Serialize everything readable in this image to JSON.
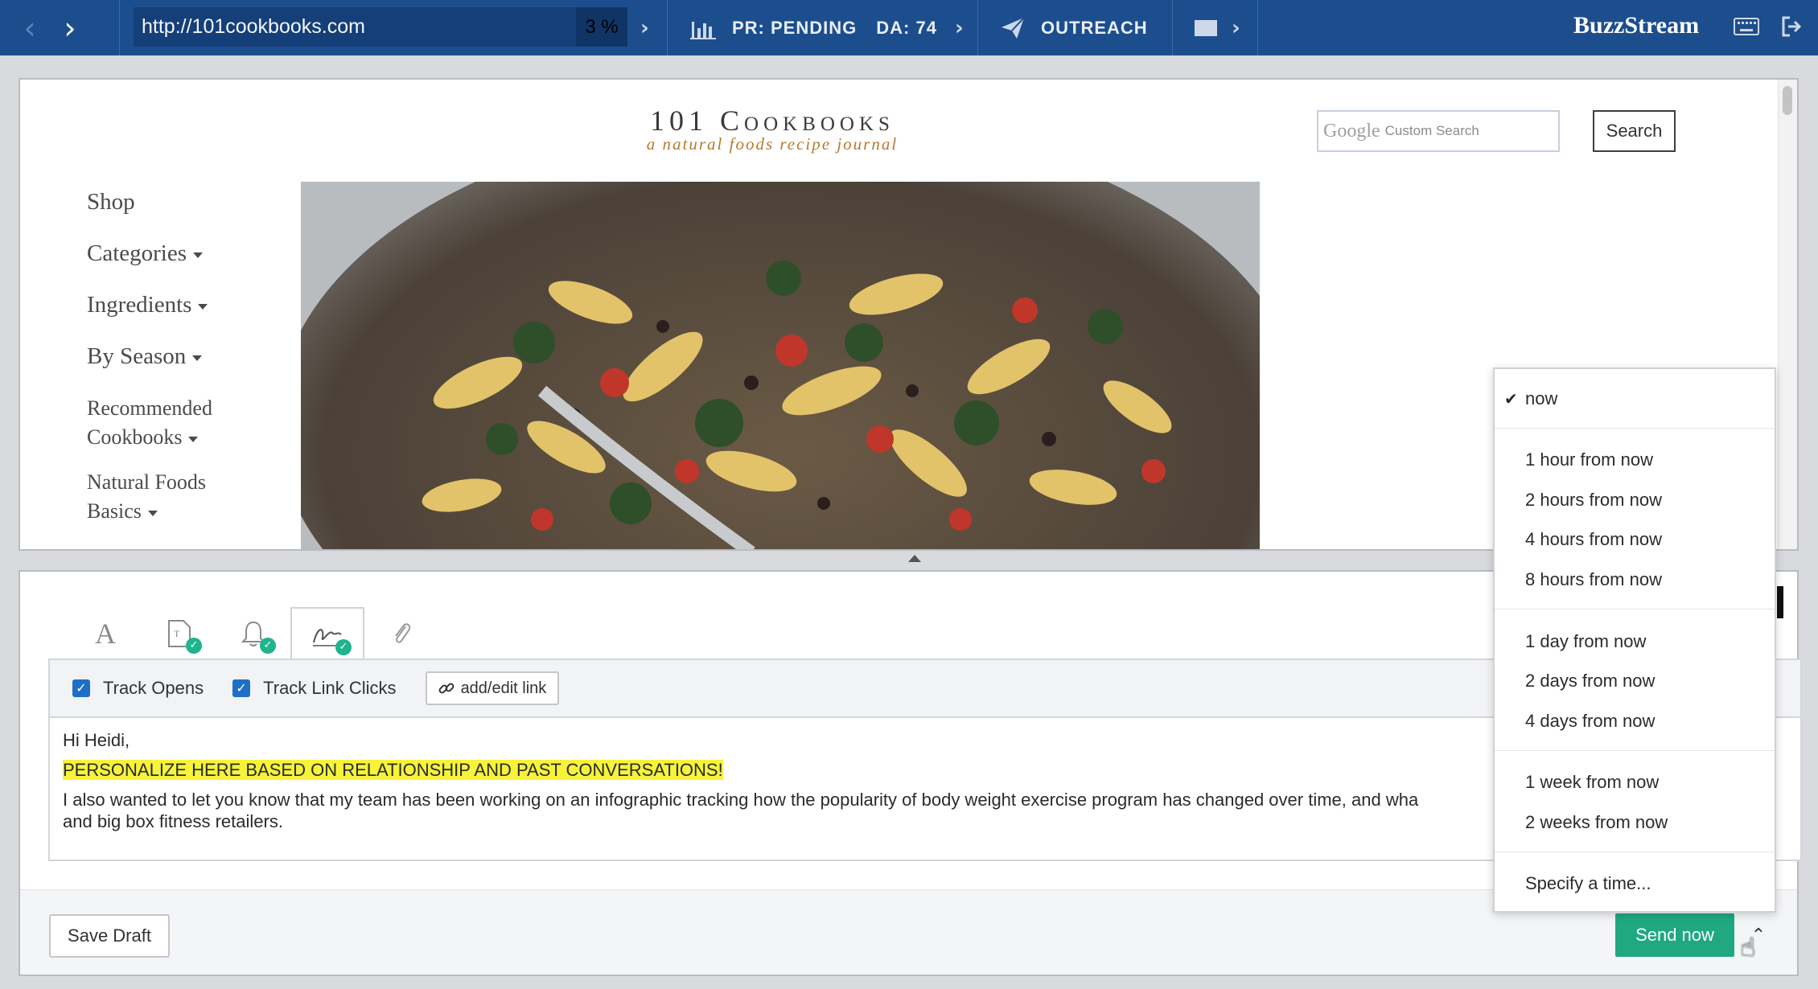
{
  "toolbar": {
    "back_icon": "chevron-left-icon",
    "forward_icon": "chevron-right-icon",
    "url": "http://101cookbooks.com",
    "url_percent": "3 %",
    "pr_label": "PR: PENDING",
    "da_label": "DA: 74",
    "outreach_label": "OUTREACH",
    "brand": "BuzzStream",
    "colors": {
      "bar": "#1c4e8e",
      "url_box": "#143f78"
    }
  },
  "site": {
    "title": "101 Cookbooks",
    "subtitle": "a natural foods recipe journal",
    "search_placeholder_brand": "Google",
    "search_placeholder": "Custom Search",
    "search_button": "Search",
    "nav": [
      {
        "label": "Shop",
        "has_caret": false
      },
      {
        "label": "Categories",
        "has_caret": true
      },
      {
        "label": "Ingredients",
        "has_caret": true
      },
      {
        "label": "By Season",
        "has_caret": true
      },
      {
        "label_line1": "Recommended",
        "label_line2": "Cookbooks",
        "has_caret": true
      },
      {
        "label_line1": "Natural Foods",
        "label_line2": "Basics",
        "has_caret": true
      }
    ]
  },
  "composer": {
    "tabs": [
      {
        "icon": "font-icon",
        "active": false
      },
      {
        "icon": "template-icon",
        "active": false,
        "checked": true
      },
      {
        "icon": "bell-icon",
        "active": false,
        "checked": true
      },
      {
        "icon": "signature-icon",
        "active": true,
        "checked": true
      },
      {
        "icon": "paperclip-icon",
        "active": false
      }
    ],
    "track_opens": "Track Opens",
    "track_link_clicks": "Track Link Clicks",
    "add_edit_link": "add/edit link",
    "body": {
      "greeting": "Hi Heidi,",
      "highlight": "PERSONALIZE HERE BASED ON RELATIONSHIP AND PAST CONVERSATIONS!",
      "paragraph_line1": "I also wanted to let you know that my team has been working on an infographic tracking how the popularity of body weight exercise program has changed over time, and wha",
      "paragraph_line2": "and big box fitness retailers."
    },
    "save_draft": "Save Draft",
    "send_now": "Send now",
    "accent": "#1fa882"
  },
  "schedule_menu": {
    "selected": "now",
    "groups": [
      [
        "now"
      ],
      [
        "1 hour from now",
        "2 hours from now",
        "4 hours from now",
        "8 hours from now"
      ],
      [
        "1 day from now",
        "2 days from now",
        "4 days from now"
      ],
      [
        "1 week from now",
        "2 weeks from now"
      ],
      [
        "Specify a time..."
      ]
    ]
  }
}
